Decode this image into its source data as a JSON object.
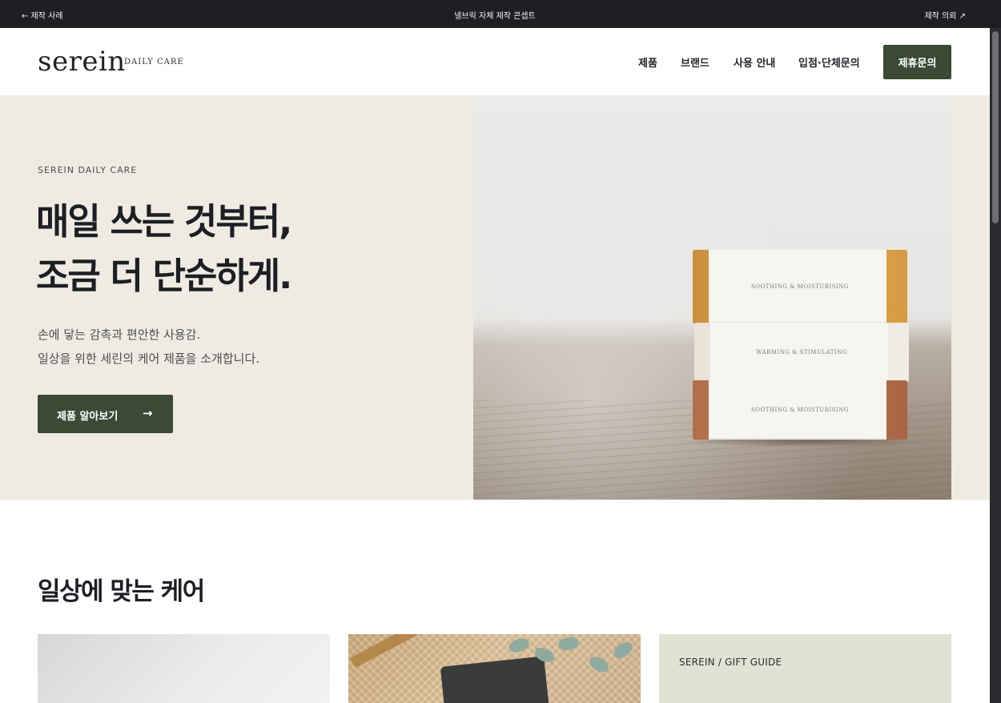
{
  "topbar": {
    "back_label": "← 제작 사례",
    "center_label": "넬브릭 자체 제작 콘셉트",
    "right_label": "제작 의뢰 ↗"
  },
  "header": {
    "logo": "serein",
    "logo_sub": "DAILY CARE",
    "nav": [
      "제품",
      "브랜드",
      "사용 안내",
      "입점·단체문의"
    ],
    "cta_label": "제휴문의"
  },
  "hero": {
    "eyebrow": "SEREIN DAILY CARE",
    "headline_line1": "매일 쓰는 것부터,",
    "headline_line2": "조금 더 단순하게.",
    "sub_line1": "손에 닿는 감촉과 편안한 사용감.",
    "sub_line2": "일상을 위한 세린의 케어 제품을 소개합니다.",
    "button_label": "제품 알아보기",
    "button_arrow": "→",
    "photo": {
      "soap_labels": [
        "SOOTHING & MOISTURISING",
        "WARMING & STIMULATING",
        "SOOTHING & MOISTURISING"
      ]
    }
  },
  "section": {
    "title": "일상에 맞는 케어",
    "cards": [
      {
        "tag": ""
      },
      {
        "tag": ""
      },
      {
        "tag": "SEREIN / GIFT GUIDE"
      }
    ]
  },
  "colors": {
    "accent": "#3a4a35",
    "hero_bg": "#efebe3",
    "topbar_bg": "#1d1f23",
    "card_gift_bg": "#dfe3d4"
  }
}
